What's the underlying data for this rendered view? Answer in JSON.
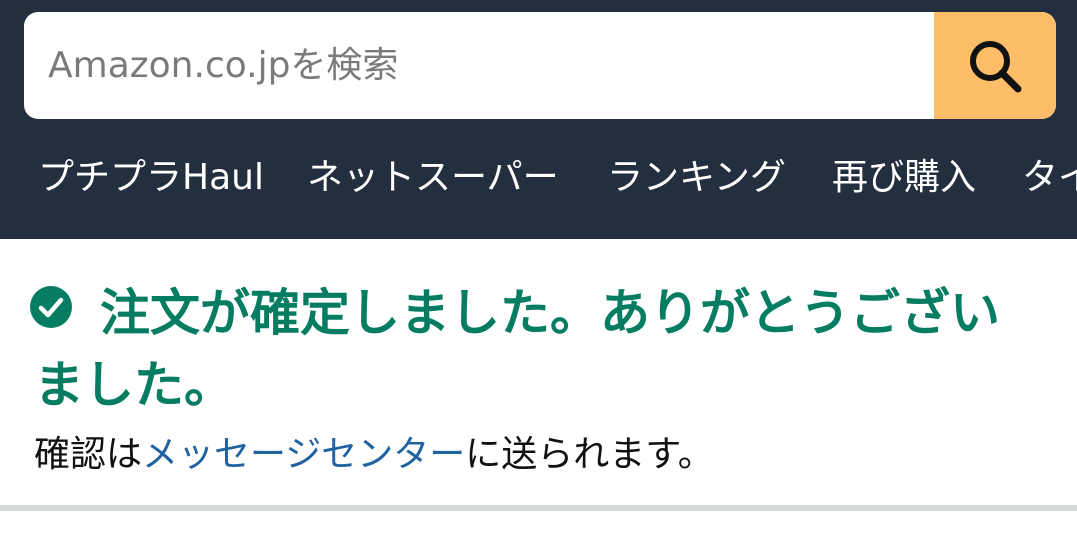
{
  "search": {
    "placeholder": "Amazon.co.jpを検索",
    "button_icon": "search-icon"
  },
  "nav": {
    "items": [
      "プチプラHaul",
      "ネットスーパー",
      "ランキング",
      "再び購入",
      "タイ"
    ]
  },
  "confirmation": {
    "icon": "check-circle-icon",
    "headline": "注文が確定しました。ありがとうございました。",
    "message_prefix": "確認は",
    "message_link": "メッセージセンター",
    "message_suffix": "に送られます。"
  },
  "colors": {
    "header_bg": "#232f3e",
    "search_button": "#febd69",
    "success_green": "#067d62",
    "link_blue": "#2162a1",
    "divider": "#d5d9d9"
  }
}
